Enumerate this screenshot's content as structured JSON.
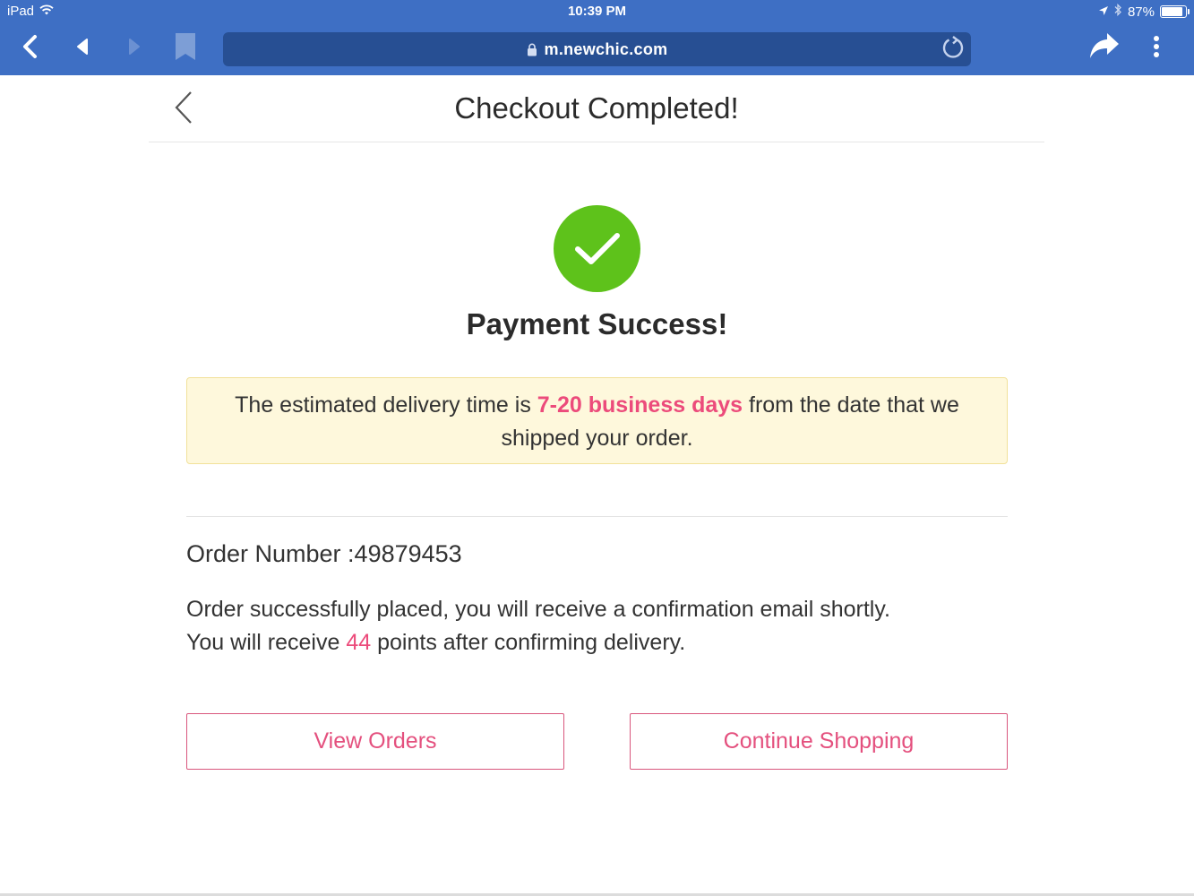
{
  "status_bar": {
    "device": "iPad",
    "time": "10:39 PM",
    "battery": "87%",
    "battery_level": 0.87
  },
  "browser": {
    "url": "m.newchic.com",
    "icons": {
      "back": "chevron-left-icon",
      "prev": "triangle-left-icon",
      "next": "triangle-right-icon",
      "bookmark": "bookmark-icon",
      "lock": "lock-icon",
      "reload": "reload-icon",
      "share": "share-arrow-icon",
      "menu": "more-vertical-icon"
    }
  },
  "page": {
    "title": "Checkout Completed!",
    "success_title": "Payment Success!",
    "notice": {
      "prefix": "The estimated delivery time is ",
      "highlight": "7-20 business days",
      "suffix": " from the date that we shipped your order."
    },
    "order_number": "Order Number :49879453",
    "message_line1": "Order successfully placed, you will receive a confirmation email shortly.",
    "points_prefix": "You will receive ",
    "points_value": "44",
    "points_suffix": " points after confirming delivery.",
    "buttons": {
      "view_orders": "View Orders",
      "continue_shopping": "Continue Shopping"
    }
  },
  "colors": {
    "chrome": "#3e6fc4",
    "accent": "#ec4b7b",
    "success": "#5ec21b",
    "notice_bg": "#fef8dc"
  }
}
